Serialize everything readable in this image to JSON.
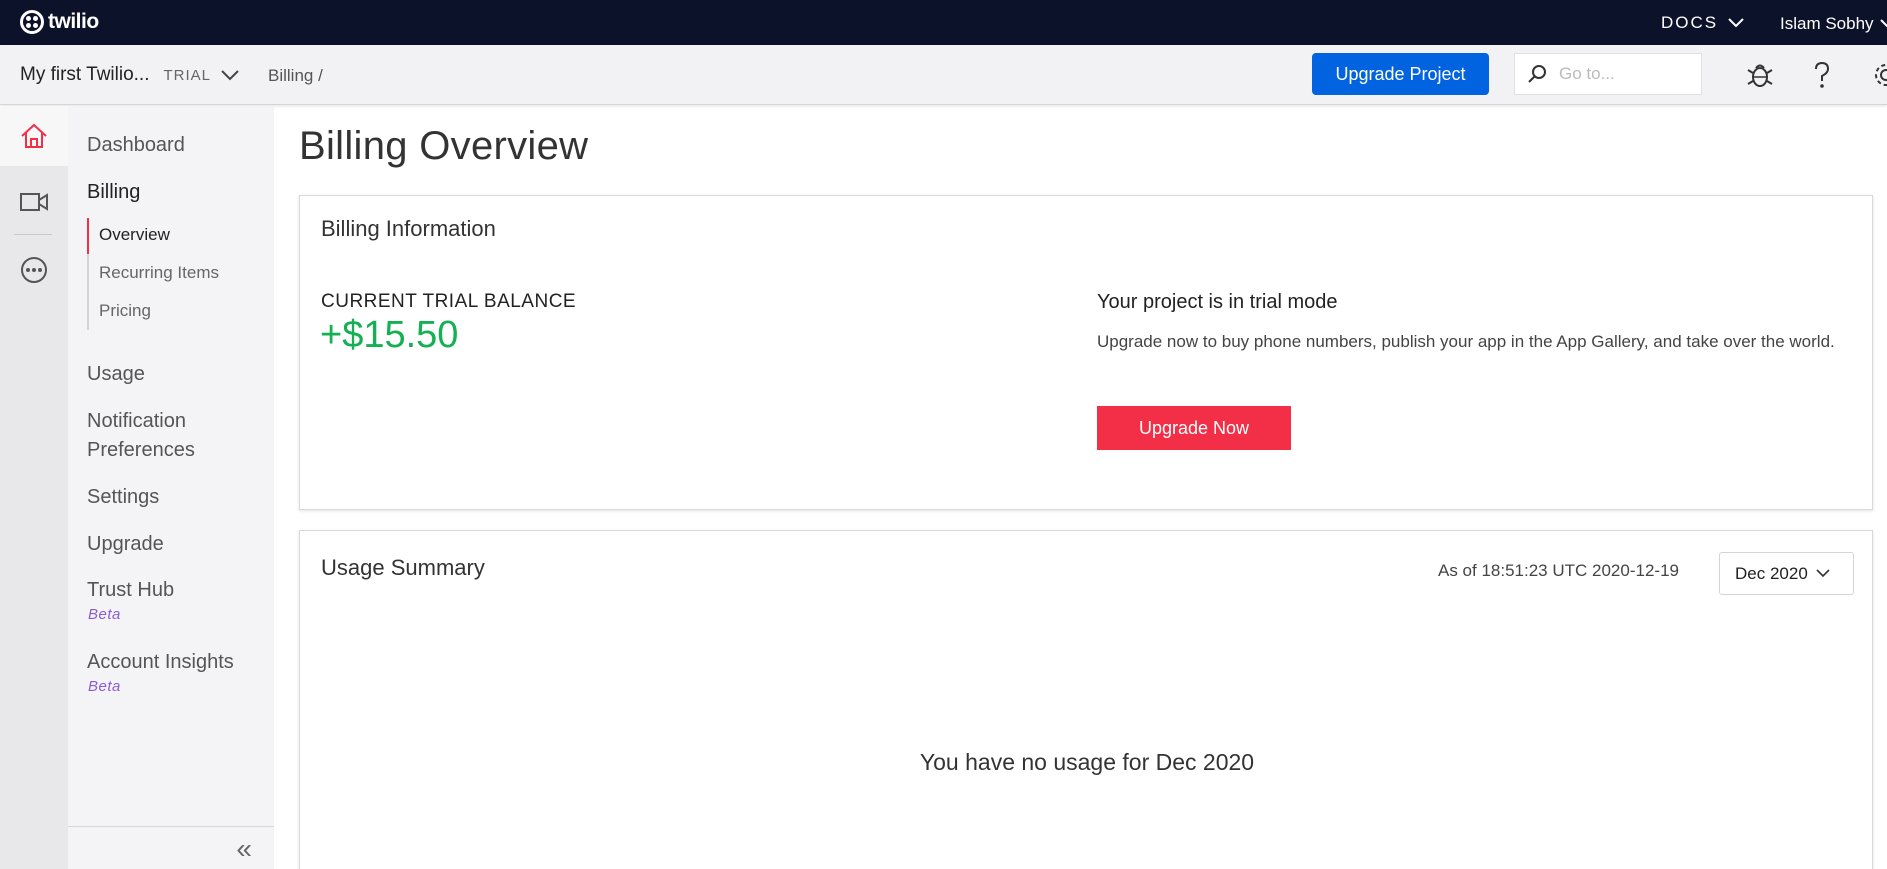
{
  "topbar": {
    "logo_text": "twilio",
    "docs_label": "DOCS",
    "user_name": "Islam Sobhy"
  },
  "subbar": {
    "project_name": "My first Twilio...",
    "project_badge": "TRIAL",
    "breadcrumb": "Billing  /",
    "upgrade_label": "Upgrade Project",
    "search_placeholder": "Go to..."
  },
  "rail": {
    "icons": [
      "home-icon",
      "video-icon",
      "more-icon"
    ]
  },
  "sidenav": {
    "items": [
      {
        "label": "Dashboard"
      },
      {
        "label": "Billing"
      },
      {
        "label": "Usage"
      },
      {
        "label": "Notification Preferences"
      },
      {
        "label": "Settings"
      },
      {
        "label": "Upgrade"
      },
      {
        "label": "Trust Hub",
        "badge": "Beta"
      },
      {
        "label": "Account Insights",
        "badge": "Beta"
      }
    ],
    "billing_sub": [
      {
        "label": "Overview"
      },
      {
        "label": "Recurring Items"
      },
      {
        "label": "Pricing"
      }
    ],
    "collapse_glyph": "«"
  },
  "main": {
    "title": "Billing Overview",
    "billing_card": {
      "title": "Billing Information",
      "balance_label": "CURRENT TRIAL BALANCE",
      "balance_value": "+$15.50",
      "trial_heading": "Your project is in trial mode",
      "trial_text": "Upgrade now to buy phone numbers, publish your app in the App Gallery, and take over the world.",
      "upgrade_now_label": "Upgrade Now"
    },
    "usage_card": {
      "title": "Usage Summary",
      "as_of": "As of 18:51:23 UTC 2020-12-19",
      "selected_month": "Dec 2020",
      "empty_message": "You have no usage for Dec 2020"
    }
  },
  "colors": {
    "topbar_bg": "#0d122b",
    "primary_blue": "#0263e0",
    "twilio_red": "#f22f46",
    "balance_green": "#14b053",
    "beta_purple": "#8c5bd8"
  }
}
